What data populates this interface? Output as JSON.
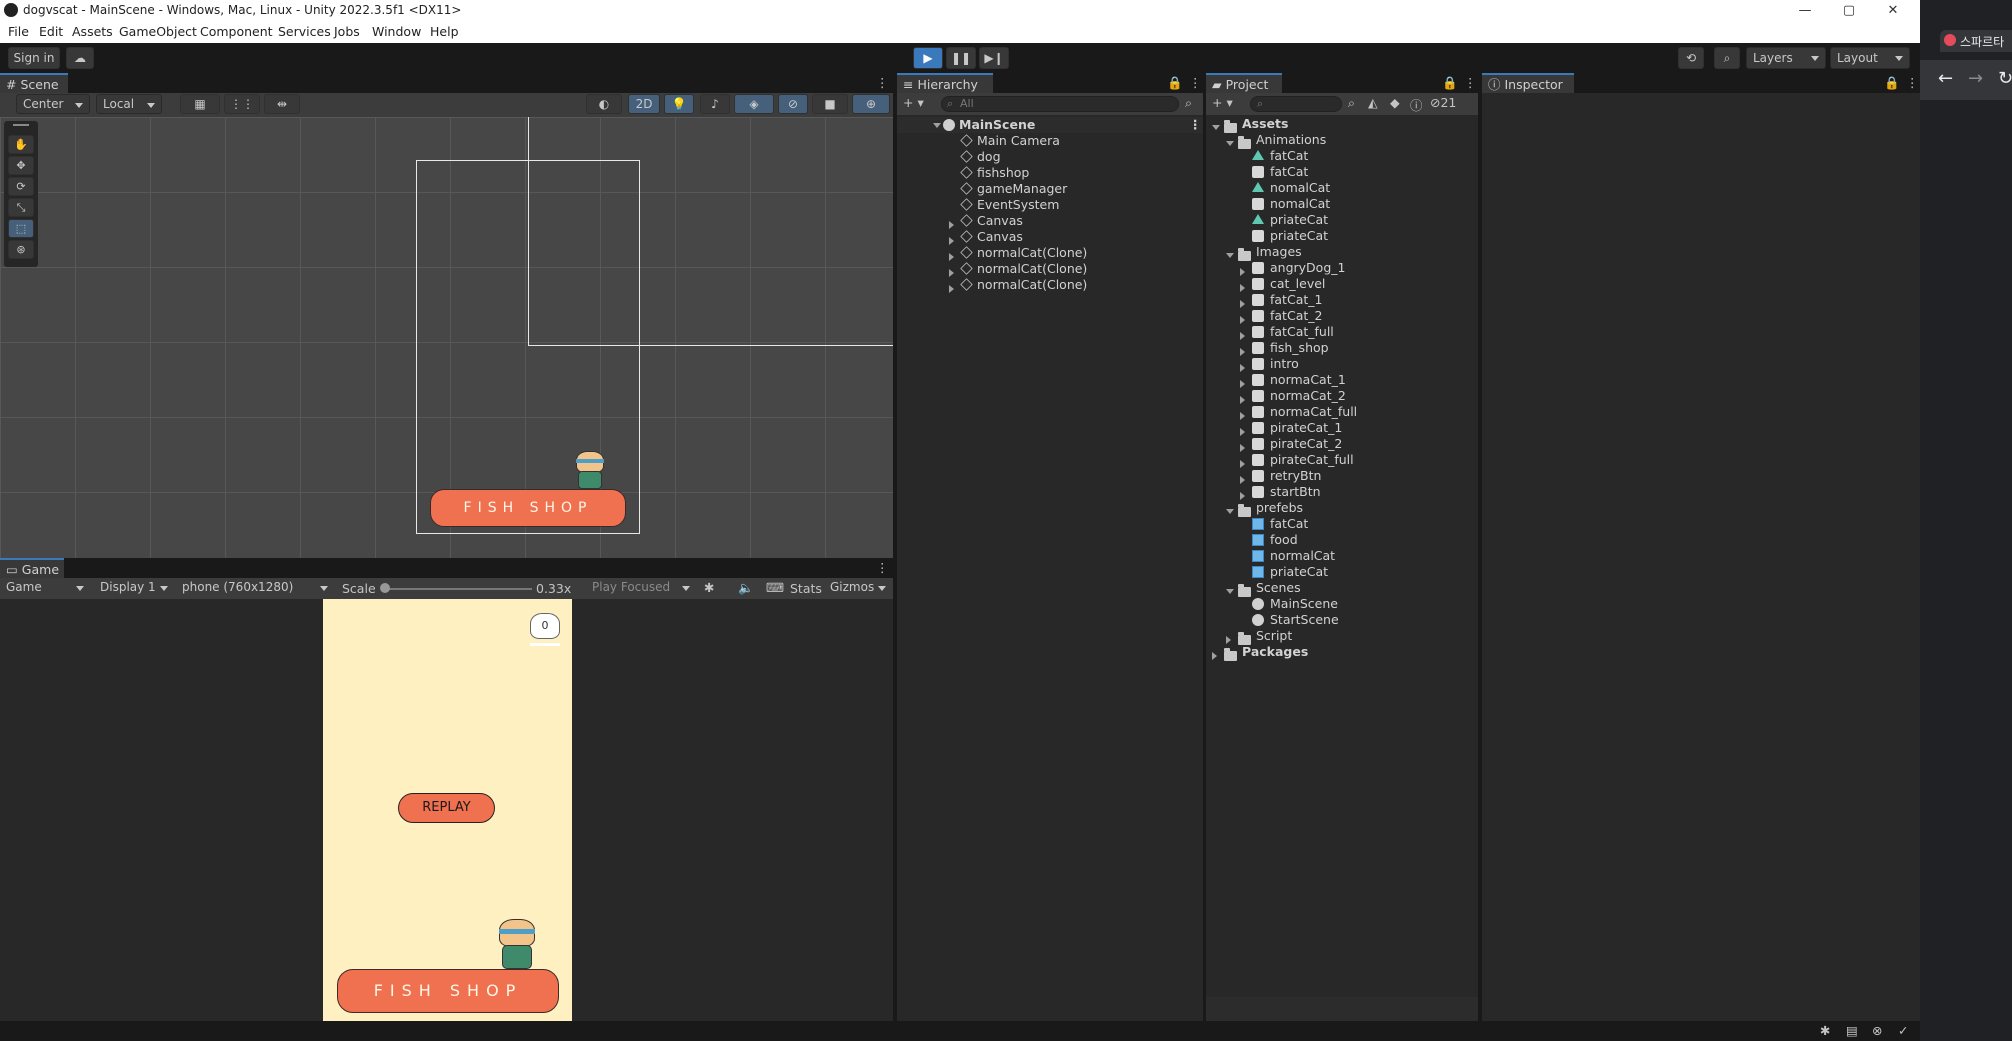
{
  "window": {
    "title": "dogvscat - MainScene - Windows, Mac, Linux - Unity 2022.3.5f1 <DX11>",
    "controls": [
      "—",
      "▢",
      "✕"
    ]
  },
  "menu": [
    "File",
    "Edit",
    "Assets",
    "GameObject",
    "Component",
    "Services",
    "Jobs",
    "Window",
    "Help"
  ],
  "toolbar": {
    "sign_in": "Sign in",
    "layers": "Layers",
    "layout": "Layout"
  },
  "scene": {
    "tab": "Scene",
    "pivot": "Center",
    "space": "Local",
    "mode_2d": "2D",
    "sign_text": "FISH SHOP"
  },
  "game": {
    "tab": "Game",
    "view": "Game",
    "display": "Display 1",
    "resolution": "phone (760x1280)",
    "scale_label": "Scale",
    "scale_value": "0.33x",
    "play_mode": "Play Focused",
    "stats": "Stats",
    "gizmos": "Gizmos",
    "score": "0",
    "replay": "REPLAY",
    "sign_text": "FISH SHOP"
  },
  "hierarchy": {
    "tab": "Hierarchy",
    "search_placeholder": "All",
    "scene": "MainScene",
    "items": [
      {
        "label": "Main Camera",
        "expandable": false
      },
      {
        "label": "dog",
        "expandable": false
      },
      {
        "label": "fishshop",
        "expandable": false
      },
      {
        "label": "gameManager",
        "expandable": false
      },
      {
        "label": "EventSystem",
        "expandable": false
      },
      {
        "label": "Canvas",
        "expandable": true
      },
      {
        "label": "Canvas",
        "expandable": true
      },
      {
        "label": "normalCat(Clone)",
        "expandable": true
      },
      {
        "label": "normalCat(Clone)",
        "expandable": true
      },
      {
        "label": "normalCat(Clone)",
        "expandable": true
      }
    ]
  },
  "project": {
    "tab": "Project",
    "hidden_count": "21",
    "tree": [
      {
        "label": "Assets",
        "depth": 0,
        "icon": "folder-icon",
        "open": true,
        "bold": true
      },
      {
        "label": "Animations",
        "depth": 1,
        "icon": "folder-icon",
        "open": true
      },
      {
        "label": "fatCat",
        "depth": 2,
        "icon": "animation-clip-icon"
      },
      {
        "label": "fatCat",
        "depth": 2,
        "icon": "animator-icon"
      },
      {
        "label": "nomalCat",
        "depth": 2,
        "icon": "animation-clip-icon"
      },
      {
        "label": "nomalCat",
        "depth": 2,
        "icon": "animator-icon"
      },
      {
        "label": "priateCat",
        "depth": 2,
        "icon": "animation-clip-icon"
      },
      {
        "label": "priateCat",
        "depth": 2,
        "icon": "animator-icon"
      },
      {
        "label": "Images",
        "depth": 1,
        "icon": "folder-icon",
        "open": true
      },
      {
        "label": "angryDog_1",
        "depth": 2,
        "icon": "sprite-icon",
        "closed": true
      },
      {
        "label": "cat_level",
        "depth": 2,
        "icon": "sprite-icon",
        "closed": true
      },
      {
        "label": "fatCat_1",
        "depth": 2,
        "icon": "sprite-icon",
        "closed": true
      },
      {
        "label": "fatCat_2",
        "depth": 2,
        "icon": "sprite-icon",
        "closed": true
      },
      {
        "label": "fatCat_full",
        "depth": 2,
        "icon": "sprite-icon",
        "closed": true
      },
      {
        "label": "fish_shop",
        "depth": 2,
        "icon": "sprite-icon",
        "closed": true
      },
      {
        "label": "intro",
        "depth": 2,
        "icon": "sprite-icon",
        "closed": true
      },
      {
        "label": "normaCat_1",
        "depth": 2,
        "icon": "sprite-icon",
        "closed": true
      },
      {
        "label": "normaCat_2",
        "depth": 2,
        "icon": "sprite-icon",
        "closed": true
      },
      {
        "label": "normaCat_full",
        "depth": 2,
        "icon": "sprite-icon",
        "closed": true
      },
      {
        "label": "pirateCat_1",
        "depth": 2,
        "icon": "sprite-icon",
        "closed": true
      },
      {
        "label": "pirateCat_2",
        "depth": 2,
        "icon": "sprite-icon",
        "closed": true
      },
      {
        "label": "pirateCat_full",
        "depth": 2,
        "icon": "sprite-icon",
        "closed": true
      },
      {
        "label": "retryBtn",
        "depth": 2,
        "icon": "sprite-icon",
        "closed": true
      },
      {
        "label": "startBtn",
        "depth": 2,
        "icon": "sprite-icon",
        "closed": true
      },
      {
        "label": "prefebs",
        "depth": 1,
        "icon": "folder-icon",
        "open": true
      },
      {
        "label": "fatCat",
        "depth": 2,
        "icon": "prefab-icon"
      },
      {
        "label": "food",
        "depth": 2,
        "icon": "prefab-icon"
      },
      {
        "label": "normalCat",
        "depth": 2,
        "icon": "prefab-icon"
      },
      {
        "label": "priateCat",
        "depth": 2,
        "icon": "prefab-icon"
      },
      {
        "label": "Scenes",
        "depth": 1,
        "icon": "folder-icon",
        "open": true
      },
      {
        "label": "MainScene",
        "depth": 2,
        "icon": "scene-icon"
      },
      {
        "label": "StartScene",
        "depth": 2,
        "icon": "scene-icon"
      },
      {
        "label": "Script",
        "depth": 1,
        "icon": "folder-icon",
        "closed": true
      },
      {
        "label": "Packages",
        "depth": 0,
        "icon": "folder-icon",
        "closed": true,
        "bold": true
      }
    ]
  },
  "inspector": {
    "tab": "Inspector"
  },
  "browser": {
    "tab_text": "스파르타"
  },
  "colors": {
    "accent": "#3a79bb",
    "panel": "#282828",
    "game_bg": "#fff0c2",
    "sign": "#f0714f"
  }
}
